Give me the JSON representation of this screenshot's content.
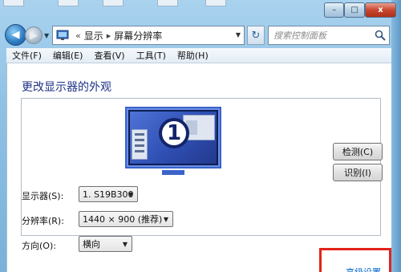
{
  "window": {
    "caption_buttons": {
      "minimize": "–",
      "maximize": "□",
      "close": "x"
    }
  },
  "nav": {
    "back_glyph": "◀",
    "forward_glyph": "▶",
    "breadcrumb_sep": "«",
    "breadcrumbs": [
      "显示",
      "屏幕分辨率"
    ],
    "crumb_sep": "▸",
    "refresh_glyph": "↻",
    "search_placeholder": "搜索控制面板"
  },
  "menu": [
    "文件(F)",
    "编辑(E)",
    "查看(V)",
    "工具(T)",
    "帮助(H)"
  ],
  "main": {
    "title": "更改显示器的外观",
    "monitor_number": "1",
    "detect_label": "检测(C)",
    "identify_label": "识别(I)",
    "fields": {
      "display": {
        "label": "显示器(S):",
        "value": "1. S19B300"
      },
      "resolution": {
        "label": "分辨率(R):",
        "value": "1440 × 900 (推荐)"
      },
      "orientation": {
        "label": "方向(O):",
        "value": "横向"
      }
    },
    "advanced_link": "高级设置"
  },
  "colors": {
    "title": "#1e3287",
    "link": "#0066cc",
    "highlight": "#e2231a"
  }
}
